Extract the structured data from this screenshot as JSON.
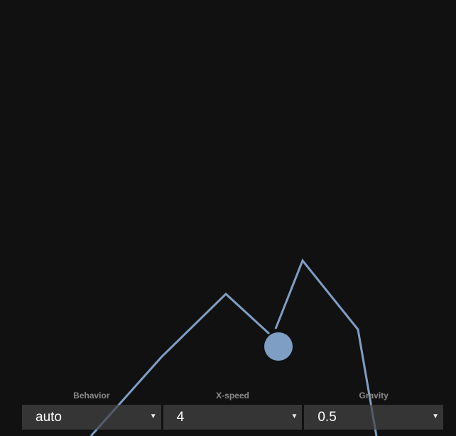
{
  "scene": {
    "background_color": "#111111",
    "line_color": "#7f9ec4",
    "ball_color": "#7f9ec4"
  },
  "controls": [
    {
      "label": "Behavior",
      "value": "auto",
      "arrow_icon": "triangle-down-icon"
    },
    {
      "label": "X-speed",
      "value": "4",
      "arrow_icon": "triangle-down-icon"
    },
    {
      "label": "Gravity",
      "value": "0.5",
      "arrow_icon": "triangle-down-icon"
    }
  ]
}
